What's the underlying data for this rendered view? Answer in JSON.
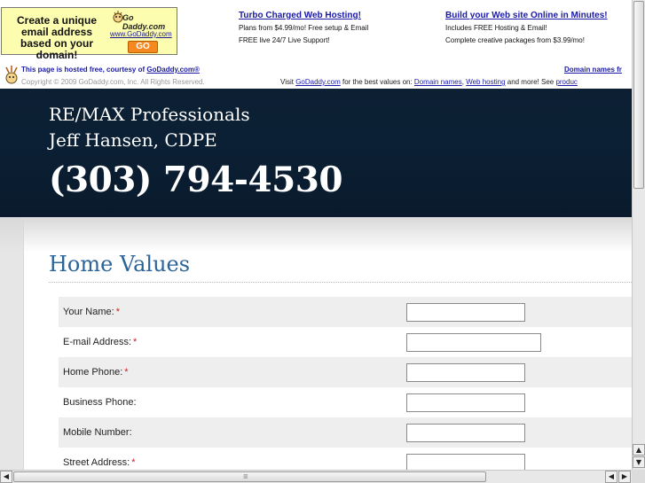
{
  "ads": {
    "promo": {
      "text": "Create a unique email address based on your domain!",
      "logo_title": "Go Daddy.com",
      "logo_url": "www.GoDaddy.com",
      "go_label": "GO"
    },
    "col1": {
      "title": "Turbo Charged Web Hosting!",
      "line1": "Plans from $4.99/mo! Free setup & Email",
      "line2": "FREE live 24/7 Live Support!"
    },
    "col2": {
      "title": "Build your Web site Online in Minutes!",
      "line1": "Includes FREE Hosting & Email!",
      "line2": "Complete creative packages from $3.99/mo!"
    },
    "hosted": {
      "prefix": "This page is hosted free, courtesy of ",
      "link": "GoDaddy.com®",
      "copyright": "Copyright © 2009 GoDaddy.com, Inc. All Rights Reserved.",
      "right_link": "Domain names fr",
      "visit_prefix": "Visit ",
      "visit_link": "GoDaddy.com",
      "visit_mid": " for the best values on: ",
      "domain_link": "Domain names",
      "comma": ", ",
      "hosting_link": "Web hosting",
      "visit_suffix": " and more! See ",
      "products_link": "produc"
    }
  },
  "banner": {
    "company": "RE/MAX Professionals",
    "agent": "Jeff Hansen, CDPE",
    "phone": "(303) 794-4530",
    "background_color": "#0b2035"
  },
  "page": {
    "title": "Home Values",
    "title_color": "#2a6499"
  },
  "form": {
    "fields": [
      {
        "label": "Your Name:",
        "required": "*",
        "value": ""
      },
      {
        "label": "E-mail Address:",
        "required": "*",
        "value": ""
      },
      {
        "label": "Home Phone:",
        "required": "*",
        "value": ""
      },
      {
        "label": "Business Phone:",
        "required": "",
        "value": ""
      },
      {
        "label": "Mobile Number:",
        "required": "",
        "value": ""
      },
      {
        "label": "Street Address:",
        "required": "*",
        "value": ""
      }
    ]
  },
  "icons": {
    "scroll_up": "▲",
    "scroll_down": "▼",
    "scroll_left": "◀",
    "scroll_right": "▶",
    "grip": "⁞⁞⁞⁞⁞"
  }
}
